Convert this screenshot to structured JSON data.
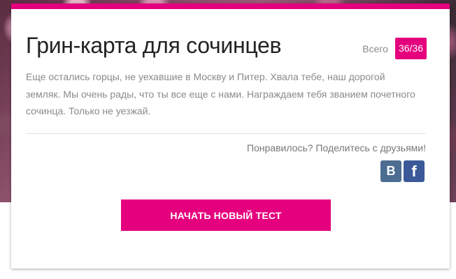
{
  "result": {
    "title": "Грин-карта для сочинцев",
    "total_label": "Всего",
    "score": "36/36",
    "description": "Еще остались горцы, не уехавшие в Москву и Питер. Хвала тебе, наш дорогой земляк. Мы очень рады, что ты все еще с нами. Награждаем тебя званием почетного сочинца. Только не уезжай."
  },
  "share": {
    "prompt": "Понравилось? Поделитесь с друзьями!",
    "buttons": [
      {
        "icon": "vk-icon",
        "glyph": "B",
        "color": "#4c6c91"
      },
      {
        "icon": "facebook-icon",
        "glyph": "f",
        "color": "#3b5998"
      }
    ]
  },
  "actions": {
    "start_new_test": "НАЧАТЬ НОВЫЙ ТЕСТ"
  },
  "colors": {
    "accent": "#e5007e"
  }
}
